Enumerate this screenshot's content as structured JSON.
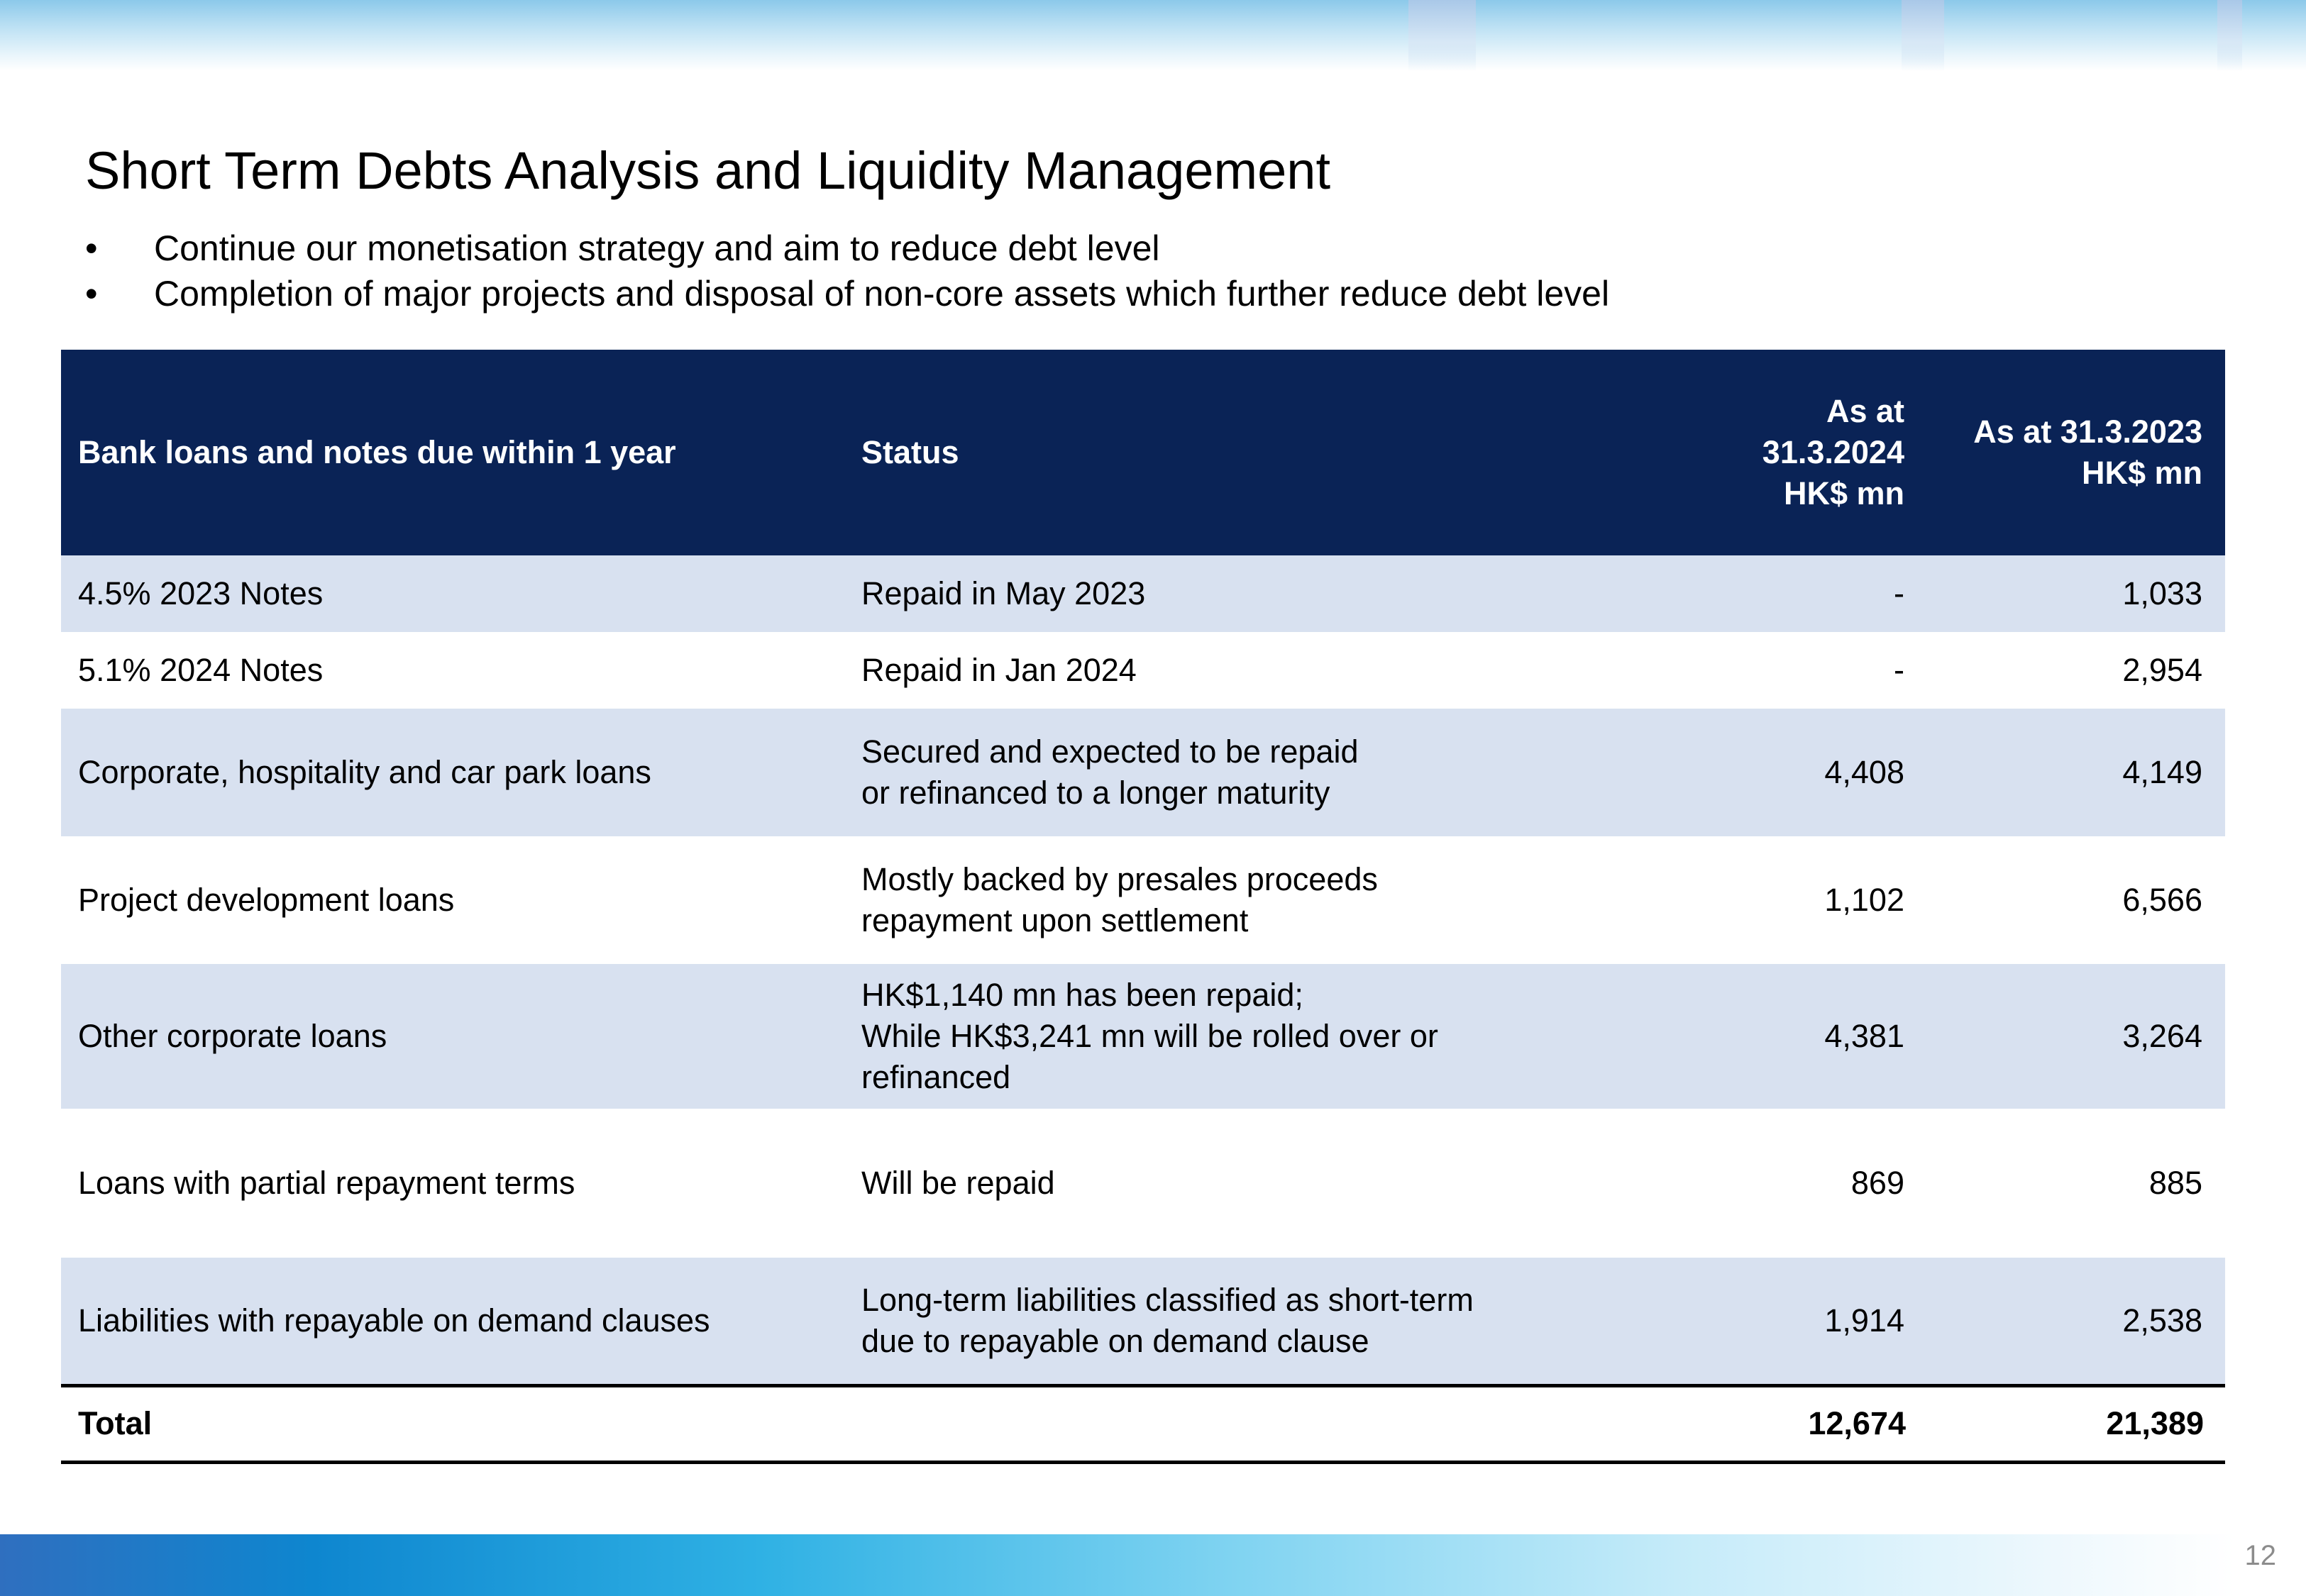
{
  "slide": {
    "title": "Short Term Debts Analysis and Liquidity Management",
    "bullet_char": "•",
    "bullets": [
      "Continue our monetisation strategy and aim to reduce debt level",
      "Completion of major projects and disposal of non-core assets which further reduce debt level"
    ],
    "page_number": "12"
  },
  "table": {
    "headers": {
      "item": "Bank loans and notes due within 1 year",
      "status": "Status",
      "col_2024_line1": "As at 31.3.2024",
      "col_2024_line2": "HK$ mn",
      "col_2023_line1": "As at 31.3.2023",
      "col_2023_line2": "HK$ mn"
    },
    "rows": [
      {
        "item": "4.5% 2023 Notes",
        "status": [
          "Repaid in May 2023"
        ],
        "v2024": "-",
        "v2023": "1,033"
      },
      {
        "item": "5.1% 2024 Notes",
        "status": [
          "Repaid in Jan 2024"
        ],
        "v2024": "-",
        "v2023": "2,954"
      },
      {
        "item": "Corporate, hospitality and car park loans",
        "status": [
          "Secured and expected to be repaid",
          "or refinanced to a longer maturity"
        ],
        "v2024": "4,408",
        "v2023": "4,149"
      },
      {
        "item": "Project development loans",
        "status": [
          "Mostly backed by presales proceeds",
          "repayment upon settlement"
        ],
        "v2024": "1,102",
        "v2023": "6,566"
      },
      {
        "item": "Other corporate loans",
        "status": [
          "HK$1,140 mn has been repaid;",
          "While HK$3,241 mn will be rolled over or",
          "refinanced"
        ],
        "v2024": "4,381",
        "v2023": "3,264"
      },
      {
        "item": "Loans with partial repayment terms",
        "status": [
          "Will be repaid"
        ],
        "v2024": "869",
        "v2023": "885"
      },
      {
        "item": "Liabilities with repayable on demand clauses",
        "status": [
          "Long-term liabilities classified as short-term",
          "due to repayable on demand clause"
        ],
        "v2024": "1,914",
        "v2023": "2,538"
      }
    ],
    "total": {
      "label": "Total",
      "v2024": "12,674",
      "v2023": "21,389"
    }
  }
}
